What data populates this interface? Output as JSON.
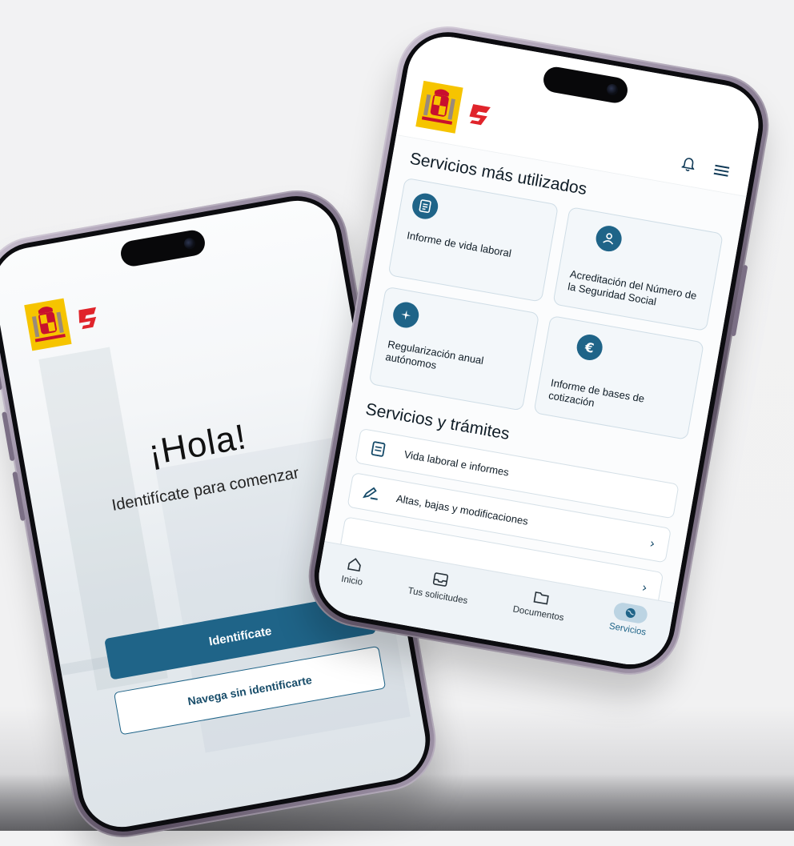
{
  "colors": {
    "brand_blue": "#1f6488",
    "escudo_yellow": "#f6c400",
    "ss_red": "#e0242b"
  },
  "left_screen": {
    "greeting": "¡Hola!",
    "subtitle": "Identifícate para comenzar",
    "primary_button": "Identifícate",
    "secondary_button": "Navega sin identificarte"
  },
  "right_screen": {
    "top_icons": [
      "bell-icon",
      "menu-icon"
    ],
    "most_used": {
      "title": "Servicios más utilizados",
      "cards": [
        {
          "label": "Informe de vida laboral",
          "icon": "document-icon"
        },
        {
          "label": "Acreditación del Número de la Seguridad Social",
          "icon": "person-icon"
        },
        {
          "label": "Regularización anual autónomos",
          "icon": "sparkle-icon"
        },
        {
          "label": "Informe de bases de cotización",
          "icon": "euro-icon"
        }
      ]
    },
    "services": {
      "title": "Servicios y trámites",
      "items": [
        {
          "label": "Vida laboral e informes",
          "icon": "document-icon"
        },
        {
          "label": "Altas, bajas y modificaciones",
          "icon": "pencil-icon"
        },
        {
          "label": "",
          "icon": ""
        }
      ]
    },
    "tabs": [
      {
        "label": "Inicio",
        "icon": "home-icon"
      },
      {
        "label": "Tus solicitudes",
        "icon": "inbox-icon"
      },
      {
        "label": "Documentos",
        "icon": "folder-icon"
      },
      {
        "label": "Servicios",
        "icon": "globe-icon",
        "active": true
      }
    ]
  }
}
